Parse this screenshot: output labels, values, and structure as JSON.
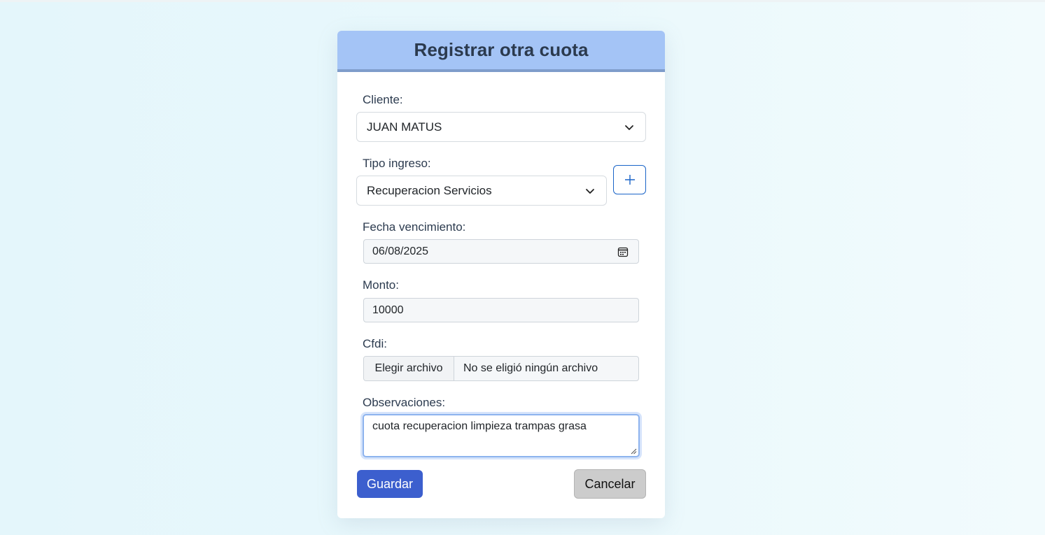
{
  "form": {
    "title": "Registrar otra cuota",
    "cliente": {
      "label": "Cliente:",
      "value": "JUAN MATUS"
    },
    "tipo_ingreso": {
      "label": "Tipo ingreso:",
      "value": "Recuperacion Servicios",
      "add_icon": "plus-icon"
    },
    "fecha_vencimiento": {
      "label": "Fecha vencimiento:",
      "value": "06/08/2025",
      "icon": "calendar-icon"
    },
    "monto": {
      "label": "Monto:",
      "value": "10000"
    },
    "cfdi": {
      "label": "Cfdi:",
      "button_label": "Elegir archivo",
      "status": "No se eligió ningún archivo"
    },
    "observaciones": {
      "label": "Observaciones:",
      "value": "cuota recuperacion limpieza trampas grasa"
    },
    "save_label": "Guardar",
    "cancel_label": "Cancelar"
  },
  "colors": {
    "header": "#a4c4f6",
    "primary_button": "#3c5fce",
    "cancel_button": "#cccccc",
    "add_button_border": "#1a64c8"
  }
}
